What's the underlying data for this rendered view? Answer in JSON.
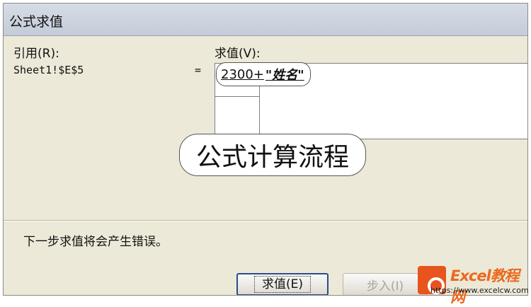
{
  "window": {
    "title": "公式求值"
  },
  "reference": {
    "label": "引用(R):",
    "value": "Sheet1!$E$5"
  },
  "equals_sign": "=",
  "evaluation": {
    "label": "求值(V):",
    "expression_number": "2300+",
    "expression_text": "\"姓名\""
  },
  "callout": {
    "text": "公式计算流程"
  },
  "status_message": "下一步求值将会产生错误。",
  "buttons": {
    "evaluate": "求值(E)",
    "step_in": "步入(I)"
  },
  "watermark": {
    "title": "Excel教程网",
    "url": "https://www.excelcw.com"
  }
}
